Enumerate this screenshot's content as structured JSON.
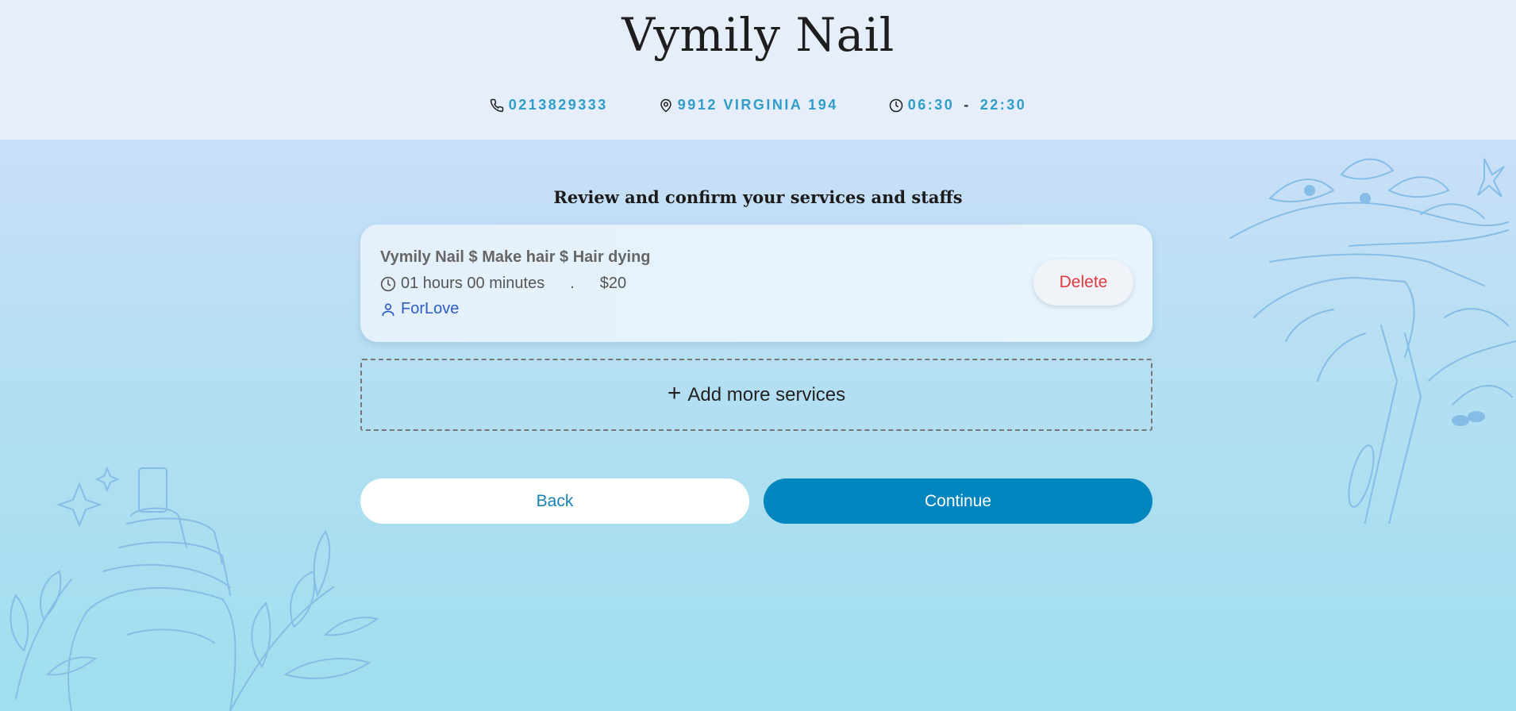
{
  "header": {
    "brand": "Vymily Nail",
    "phone": "0213829333",
    "address": "9912 VIRGINIA 194",
    "hours_open": "06:30",
    "hours_separator": "-",
    "hours_close": "22:30"
  },
  "review": {
    "title": "Review and confirm your services and staffs"
  },
  "service": {
    "name": "Vymily Nail $ Make hair $ Hair dying",
    "duration": "01 hours 00 minutes",
    "separator": ".",
    "price": "$20",
    "staff": "ForLove",
    "delete_label": "Delete"
  },
  "add_more": {
    "plus": "+",
    "label": "Add more services"
  },
  "actions": {
    "back_label": "Back",
    "continue_label": "Continue"
  },
  "colors": {
    "accent": "#0086bf",
    "info_text": "#2f9cc9",
    "delete": "#e0393e",
    "staff": "#2c5dc4"
  },
  "icons": {
    "phone": "phone-icon",
    "location": "location-pin-icon",
    "clock": "clock-icon",
    "user": "user-icon"
  }
}
